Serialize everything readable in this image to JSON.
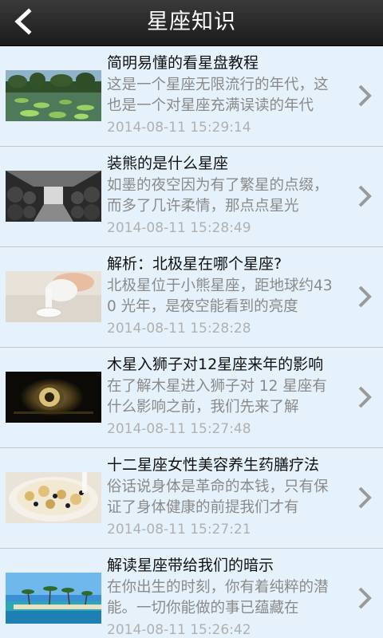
{
  "header": {
    "title": "星座知识",
    "back_icon": "back-arrow-icon"
  },
  "items": [
    {
      "title": "简明易懂的看星盘教程",
      "summary": "这是一个星座无限流行的年代，这也是一个对星座充满误读的年代",
      "time": "2014-08-11 15:29:14",
      "image": "lotus-pond-image"
    },
    {
      "title": "装熊的是什么星座",
      "summary": "如墨的夜空因为有了繁星的点缀，而多了几许柔情，那点点星光",
      "time": "2014-08-11 15:28:49",
      "image": "wine-cellar-image"
    },
    {
      "title": "解析：北极星在哪个星座?",
      "summary": "北极星位于小熊星座，距地球约430 光年，是夜空能看到的亮度",
      "time": "2014-08-11 15:28:28",
      "image": "pouring-milk-image"
    },
    {
      "title": "木星入狮子对12星座来年的影响",
      "summary": "在了解木星进入狮子对 12 星座有什么影响之前，我们先来了解",
      "time": "2014-08-11 15:27:48",
      "image": "glowing-object-image"
    },
    {
      "title": "十二星座女性美容养生药膳疗法",
      "summary": "俗话说身体是革命的本钱，只有保证了身体健康的前提我们才有",
      "time": "2014-08-11 15:27:21",
      "image": "cereal-bowl-image"
    },
    {
      "title": "解读星座带给我们的暗示",
      "summary": "在你出生的时刻，你有着纯粹的潜能。一切你能做的事已蕴藏在",
      "time": "2014-08-11 15:26:42",
      "image": "tropical-beach-image"
    }
  ]
}
